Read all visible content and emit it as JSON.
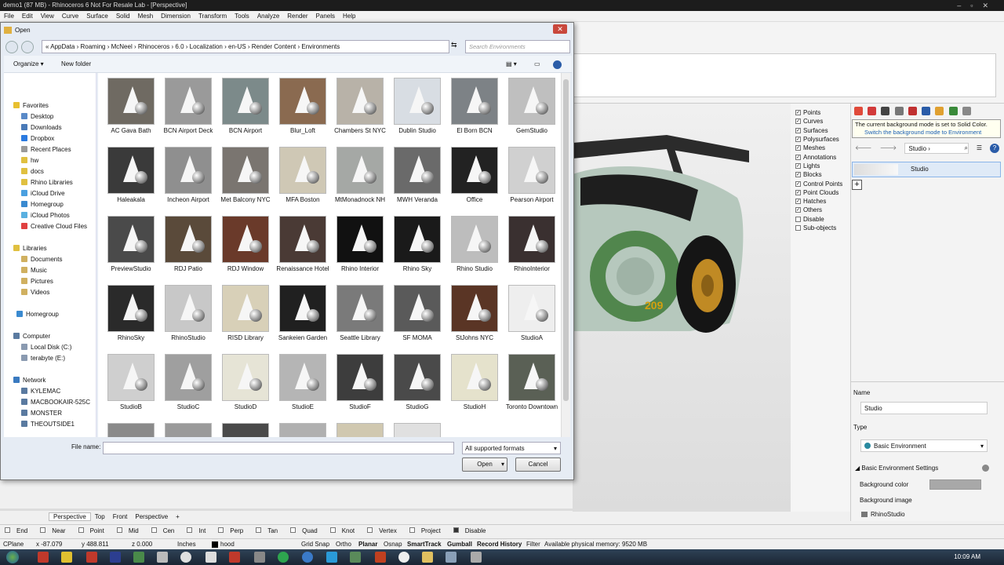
{
  "window": {
    "title": "demo1 (87 MB) - Rhinoceros 6 Not For Resale Lab - [Perspective]"
  },
  "menu": [
    "File",
    "Edit",
    "View",
    "Curve",
    "Surface",
    "Solid",
    "Mesh",
    "Dimension",
    "Transform",
    "Tools",
    "Analyze",
    "Render",
    "Panels",
    "Help"
  ],
  "dialog": {
    "title": "Open",
    "breadcrumbs": "« AppData › Roaming › McNeel › Rhinoceros › 6.0 › Localization › en-US › Render Content › Environments",
    "search_placeholder": "Search Environments",
    "organize": "Organize ▾",
    "new_folder": "New folder",
    "nav": {
      "favorites": "Favorites",
      "fav_items": [
        "Desktop",
        "Downloads",
        "Dropbox",
        "Recent Places",
        "hw",
        "docs",
        "Rhino Libraries",
        "iCloud Drive",
        "Homegroup",
        "iCloud Photos",
        "Creative Cloud Files"
      ],
      "libraries": "Libraries",
      "lib_items": [
        "Documents",
        "Music",
        "Pictures",
        "Videos"
      ],
      "homegroup": "Homegroup",
      "computer": "Computer",
      "comp_items": [
        "Local Disk (C:)",
        "terabyte (E:)"
      ],
      "network": "Network",
      "net_items": [
        "KYLEMAC",
        "MACBOOKAIR-525C",
        "MONSTER",
        "THEOUTSIDE1"
      ]
    },
    "files": [
      {
        "name": "AC Gava Bath",
        "bg": "#6f6a62"
      },
      {
        "name": "BCN Airport Deck",
        "bg": "#9a9a9a"
      },
      {
        "name": "BCN Airport",
        "bg": "#7c8a8a"
      },
      {
        "name": "Blur_Loft",
        "bg": "#8a6a50"
      },
      {
        "name": "Chambers St NYC",
        "bg": "#b8b2a8"
      },
      {
        "name": "Dublin Studio",
        "bg": "#d8dde3"
      },
      {
        "name": "El Born BCN",
        "bg": "#7d8286"
      },
      {
        "name": "GemStudio",
        "bg": "#bfbfbf"
      },
      {
        "name": "Haleakala",
        "bg": "#3a3a3a"
      },
      {
        "name": "Incheon Airport",
        "bg": "#8f8f8f"
      },
      {
        "name": "Met Balcony NYC",
        "bg": "#7a7570"
      },
      {
        "name": "MFA Boston",
        "bg": "#cfc8b5"
      },
      {
        "name": "MtMonadnock NH",
        "bg": "#a5a8a5"
      },
      {
        "name": "MWH Veranda",
        "bg": "#6a6a6a"
      },
      {
        "name": "Office",
        "bg": "#222222"
      },
      {
        "name": "Pearson Airport",
        "bg": "#d0d0d0"
      },
      {
        "name": "PreviewStudio",
        "bg": "#4a4a4a"
      },
      {
        "name": "RDJ Patio",
        "bg": "#5a4a3a"
      },
      {
        "name": "RDJ Window",
        "bg": "#6a3a2a"
      },
      {
        "name": "Renaissance Hotel",
        "bg": "#4a3a35"
      },
      {
        "name": "Rhino Interior",
        "bg": "#111111"
      },
      {
        "name": "Rhino Sky",
        "bg": "#1a1a1a"
      },
      {
        "name": "Rhino Studio",
        "bg": "#bdbdbd"
      },
      {
        "name": "RhinoInterior",
        "bg": "#3a3030"
      },
      {
        "name": "RhinoSky",
        "bg": "#2a2a2a"
      },
      {
        "name": "RhinoStudio",
        "bg": "#c8c8c8"
      },
      {
        "name": "RISD Library",
        "bg": "#d8d0b8"
      },
      {
        "name": "Sankeien Garden",
        "bg": "#202020"
      },
      {
        "name": "Seattle Library",
        "bg": "#7a7a7a"
      },
      {
        "name": "SF MOMA",
        "bg": "#5a5a5a"
      },
      {
        "name": "StJohns NYC",
        "bg": "#5a3525"
      },
      {
        "name": "StudioA",
        "bg": "#eeeeee"
      },
      {
        "name": "StudioB",
        "bg": "#cfcfcf"
      },
      {
        "name": "StudioC",
        "bg": "#9f9f9f"
      },
      {
        "name": "StudioD",
        "bg": "#e6e4d6"
      },
      {
        "name": "StudioE",
        "bg": "#b5b5b5"
      },
      {
        "name": "StudioF",
        "bg": "#3d3d3d"
      },
      {
        "name": "StudioG",
        "bg": "#4a4a4a"
      },
      {
        "name": "StudioH",
        "bg": "#e5e2cc"
      },
      {
        "name": "Toronto Downtown",
        "bg": "#5a6055"
      }
    ],
    "partial_row_bg": [
      "#8a8a8a",
      "#9a9a9a",
      "#4a4a4a",
      "#b0b0b0",
      "#d0c8b0",
      "#e0e0e0"
    ],
    "file_name_label": "File name:",
    "file_name_value": "",
    "file_type": "All supported formats",
    "open": "Open",
    "cancel": "Cancel"
  },
  "layers": [
    "Points",
    "Curves",
    "Surfaces",
    "Polysurfaces",
    "Meshes",
    "Annotations",
    "Lights",
    "Blocks",
    "Control Points",
    "Point Clouds",
    "Hatches",
    "Others",
    "Disable",
    "Sub-objects"
  ],
  "panel": {
    "tip_line1": "The current background mode is set to Solid Color.",
    "tip_line2": "Switch the background mode to Environment",
    "breadcrumb": "Studio ›",
    "selected": "Studio",
    "name_label": "Name",
    "name_value": "Studio",
    "type_label": "Type",
    "type_value": "Basic Environment",
    "section": "Basic Environment Settings",
    "bg_color_label": "Background color",
    "bg_image_label": "Background image",
    "bg_image_value": "RhinoStudio"
  },
  "view_tabs": [
    "Perspective",
    "Top",
    "Front",
    "Perspective"
  ],
  "osnaps": [
    {
      "label": "End",
      "on": false
    },
    {
      "label": "Near",
      "on": false
    },
    {
      "label": "Point",
      "on": false
    },
    {
      "label": "Mid",
      "on": false
    },
    {
      "label": "Cen",
      "on": false
    },
    {
      "label": "Int",
      "on": false
    },
    {
      "label": "Perp",
      "on": false
    },
    {
      "label": "Tan",
      "on": false
    },
    {
      "label": "Quad",
      "on": false
    },
    {
      "label": "Knot",
      "on": false
    },
    {
      "label": "Vertex",
      "on": false
    },
    {
      "label": "Project",
      "on": false
    },
    {
      "label": "Disable",
      "on": true
    }
  ],
  "status": {
    "cplane": "CPlane",
    "x": "x -87.079",
    "y": "y 488.811",
    "z": "z 0.000",
    "units": "Inches",
    "layer": "hood",
    "grid_snap": "Grid Snap",
    "ortho": "Ortho",
    "planar": "Planar",
    "osnap": "Osnap",
    "smarttrack": "SmartTrack",
    "gumball": "Gumball",
    "record": "Record History",
    "filter": "Filter",
    "memory": "Available physical memory: 9520 MB"
  },
  "clock": "10:09 AM",
  "colors": {
    "accent": "#1a5fb4",
    "dialog_bg": "#e6ecf4",
    "car_body": "#b6c8bd",
    "car_green": "#3f7a3a"
  }
}
